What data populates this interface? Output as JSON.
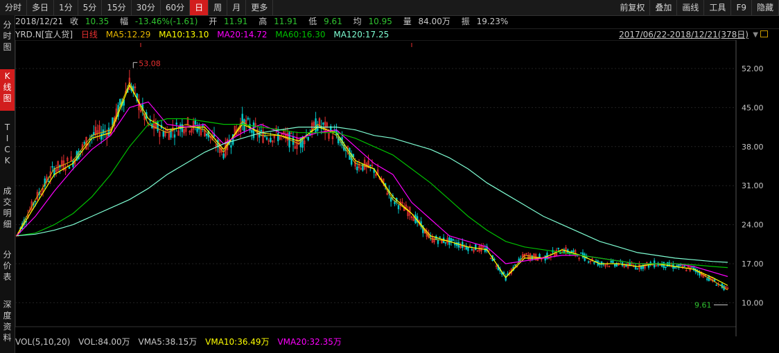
{
  "toolbar": {
    "periods": [
      "分时",
      "多日",
      "1分",
      "5分",
      "15分",
      "30分",
      "60分",
      "日",
      "周",
      "月",
      "更多"
    ],
    "active_period": "日",
    "right_items": [
      "前复权",
      "叠加",
      "画线",
      "工具",
      "F9",
      "隐藏"
    ]
  },
  "sidebar": {
    "items": [
      "分时图",
      "K线图",
      "TICK",
      "成交明细",
      "分价表",
      "深度资料"
    ],
    "active": "K线图"
  },
  "quote": {
    "date": "2018/12/21",
    "close_label": "收",
    "close": "10.35",
    "change_label": "幅",
    "change": "-13.46%(-1.61)",
    "open_label": "开",
    "open": "11.91",
    "high_label": "高",
    "high": "11.91",
    "low_label": "低",
    "low": "9.61",
    "avg_label": "均",
    "avg": "10.95",
    "volume_label": "量",
    "volume": "84.00万",
    "amplitude_label": "振",
    "amplitude": "19.23%"
  },
  "ma_legend": {
    "symbol": "YRD.N",
    "name": "[宜人贷]",
    "period": "日线",
    "ma5": "MA5:12.29",
    "ma10": "MA10:13.10",
    "ma20": "MA20:14.72",
    "ma60": "MA60:16.30",
    "ma120": "MA120:17.25"
  },
  "date_range": "2017/06/22-2018/12/21(378日)",
  "annotations": {
    "max": "53.08",
    "min": "9.61"
  },
  "volume_legend": {
    "indicator": "VOL(5,10,20)",
    "vol": "VOL:84.00万",
    "vma5": "VMA5:38.15万",
    "vma10": "VMA10:36.49万",
    "vma20": "VMA20:32.35万"
  },
  "colors": {
    "up": "#e83030",
    "down": "#00c8c8",
    "ma5": "#ffffff",
    "ma10": "#ffff00",
    "ma20": "#ff00ff",
    "ma60": "#00c000",
    "ma120": "#7fffd4",
    "active": "#d21d1d"
  },
  "chart_data": {
    "type": "line",
    "title": "YRD.N [宜人贷] 日线",
    "y_ticks": [
      "52.00",
      "45.00",
      "38.00",
      "31.00",
      "24.00",
      "17.00",
      "10.00"
    ],
    "ylim": [
      6.2,
      55.6
    ],
    "x": [
      0,
      10,
      20,
      30,
      40,
      50,
      60,
      70,
      80,
      90,
      100,
      110,
      120,
      130,
      140,
      150,
      160,
      170,
      180,
      190,
      200,
      210,
      220,
      230,
      240,
      250,
      260,
      270,
      280,
      290,
      300,
      310,
      320,
      330,
      340,
      350,
      360,
      370,
      378
    ],
    "series": [
      {
        "name": "MA5",
        "values": [
          22.0,
          28.5,
          34.0,
          35.5,
          40.0,
          41.0,
          49.5,
          42.0,
          40.5,
          42.0,
          41.0,
          37.0,
          42.5,
          40.0,
          40.0,
          38.5,
          42.0,
          40.0,
          35.0,
          34.0,
          28.5,
          26.0,
          21.5,
          21.0,
          20.0,
          19.5,
          14.5,
          18.5,
          18.0,
          19.5,
          18.5,
          17.0,
          17.0,
          16.5,
          17.0,
          16.5,
          16.0,
          14.0,
          12.3
        ]
      },
      {
        "name": "MA10",
        "values": [
          22.0,
          27.5,
          33.0,
          35.0,
          39.5,
          40.5,
          49.0,
          43.0,
          41.0,
          41.5,
          41.5,
          37.5,
          42.0,
          40.5,
          40.0,
          39.0,
          41.5,
          40.5,
          35.5,
          34.0,
          29.0,
          26.0,
          22.0,
          21.0,
          20.0,
          19.5,
          14.5,
          18.0,
          18.0,
          19.5,
          18.5,
          17.0,
          17.0,
          16.5,
          17.0,
          16.5,
          16.0,
          14.5,
          13.1
        ]
      },
      {
        "name": "MA20",
        "values": [
          22.0,
          25.5,
          30.0,
          34.0,
          37.5,
          40.0,
          45.0,
          46.0,
          42.0,
          41.5,
          42.0,
          38.5,
          40.5,
          42.0,
          40.5,
          39.5,
          40.5,
          41.0,
          38.0,
          35.0,
          33.0,
          28.0,
          25.0,
          22.0,
          21.0,
          20.0,
          17.0,
          17.5,
          18.0,
          18.5,
          18.5,
          18.0,
          17.5,
          17.0,
          17.0,
          17.0,
          16.5,
          15.5,
          14.7
        ]
      },
      {
        "name": "MA60",
        "values": [
          22.0,
          22.5,
          24.0,
          26.0,
          29.0,
          33.0,
          38.0,
          42.0,
          43.0,
          43.0,
          42.5,
          42.0,
          42.0,
          41.5,
          41.0,
          40.5,
          40.5,
          40.5,
          39.5,
          38.0,
          36.5,
          34.0,
          31.5,
          28.5,
          25.5,
          23.0,
          21.0,
          20.0,
          19.5,
          19.0,
          18.5,
          18.0,
          17.5,
          17.0,
          17.0,
          17.0,
          16.8,
          16.5,
          16.3
        ]
      },
      {
        "name": "MA120",
        "values": [
          22.0,
          22.3,
          23.0,
          24.0,
          25.5,
          27.0,
          28.5,
          30.5,
          33.0,
          35.0,
          37.0,
          38.5,
          39.5,
          40.5,
          41.0,
          41.5,
          41.5,
          41.5,
          41.0,
          40.0,
          39.5,
          38.5,
          37.5,
          36.0,
          34.0,
          31.5,
          29.5,
          27.5,
          25.5,
          24.0,
          22.5,
          21.0,
          20.0,
          19.0,
          18.5,
          18.0,
          17.7,
          17.4,
          17.25
        ]
      }
    ]
  }
}
